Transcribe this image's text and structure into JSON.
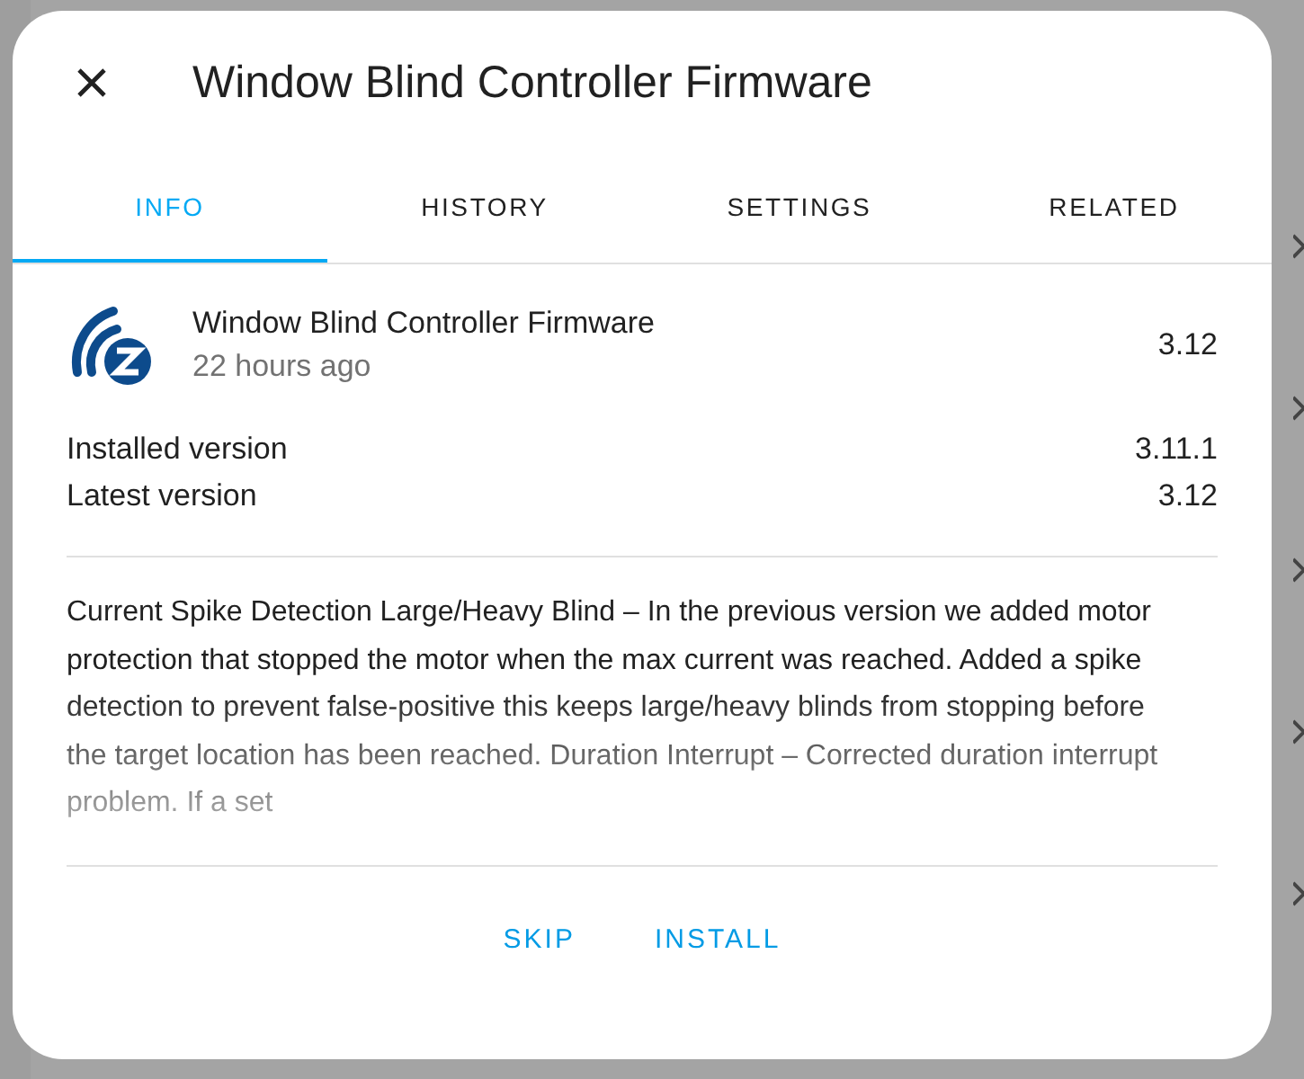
{
  "dialog": {
    "title": "Window Blind Controller Firmware"
  },
  "tabs": [
    {
      "label": "INFO",
      "selected": true
    },
    {
      "label": "HISTORY",
      "selected": false
    },
    {
      "label": "SETTINGS",
      "selected": false
    },
    {
      "label": "RELATED",
      "selected": false
    }
  ],
  "update": {
    "name": "Window Blind Controller Firmware",
    "time": "22 hours ago",
    "version": "3.12"
  },
  "versions": [
    {
      "label": "Installed version",
      "value": "3.11.1"
    },
    {
      "label": "Latest version",
      "value": "3.12"
    }
  ],
  "release_notes": "Current Spike Detection Large/Heavy Blind – In the previous version we added motor protection that stopped the motor when the max current was reached. Added a spike detection to prevent false-positive this keeps large/heavy blinds from stopping before the target location has been reached. Duration Interrupt – Corrected duration interrupt problem. If a set",
  "buttons": [
    "SKIP",
    "INSTALL"
  ]
}
